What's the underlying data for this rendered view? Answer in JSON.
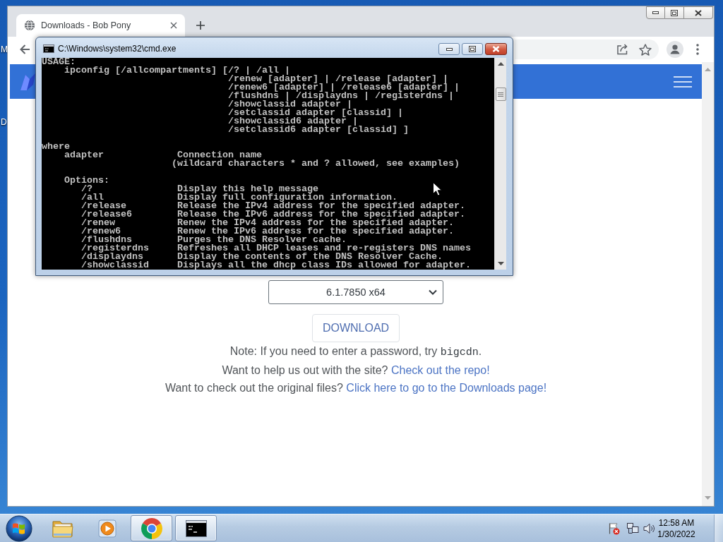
{
  "desktop": {
    "icon_labels": [
      "M",
      "D"
    ]
  },
  "browser": {
    "tabs": [
      {
        "title": "Downloads - Bob Pony",
        "selected": true
      }
    ],
    "page": {
      "version_select": {
        "value": "6.1.7850 x64"
      },
      "download_button": "DOWNLOAD",
      "notes": [
        {
          "segments": [
            {
              "kind": "text",
              "text": "Note: If you need to enter a password, try "
            },
            {
              "kind": "code",
              "text": "bigcdn"
            },
            {
              "kind": "text",
              "text": "."
            }
          ]
        },
        {
          "segments": [
            {
              "kind": "text",
              "text": "Want to help us out with the site? "
            },
            {
              "kind": "link",
              "text": "Check out the repo!"
            }
          ]
        },
        {
          "segments": [
            {
              "kind": "text",
              "text": "Want to check out the original files? "
            },
            {
              "kind": "link",
              "text": "Click here to go to the Downloads page!"
            }
          ]
        }
      ]
    }
  },
  "console_window": {
    "title": "C:\\Windows\\system32\\cmd.exe",
    "blocks": [
      [
        "USAGE:",
        "    ipconfig [/allcompartments] [/? | /all |",
        "                                 /renew [adapter] | /release [adapter] |",
        "                                 /renew6 [adapter] | /release6 [adapter] |",
        "                                 /flushdns | /displaydns | /registerdns |",
        "                                 /showclassid adapter |",
        "                                 /setclassid adapter [classid] |",
        "                                 /showclassid6 adapter |",
        "                                 /setclassid6 adapter [classid] ]"
      ],
      [
        "where",
        "    adapter             Connection name",
        "                       (wildcard characters * and ? allowed, see examples)"
      ],
      [
        "    Options:",
        "       /?               Display this help message",
        "       /all             Display full configuration information.",
        "       /release         Release the IPv4 address for the specified adapter.",
        "       /release6        Release the IPv6 address for the specified adapter.",
        "       /renew           Renew the IPv4 address for the specified adapter.",
        "       /renew6          Renew the IPv6 address for the specified adapter.",
        "       /flushdns        Purges the DNS Resolver cache.",
        "       /registerdns     Refreshes all DHCP leases and re-registers DNS names",
        "       /displaydns      Display the contents of the DNS Resolver Cache.",
        "       /showclassid     Displays all the dhcp class IDs allowed for adapter."
      ]
    ]
  },
  "taskbar": {
    "apps": [
      {
        "kind": "file-explorer",
        "running": false
      },
      {
        "kind": "media-player",
        "running": false
      },
      {
        "kind": "web-browser",
        "running": true
      },
      {
        "kind": "command-prompt",
        "running": true
      }
    ],
    "clock": {
      "time": "12:58 AM",
      "date": "1/30/2022"
    }
  }
}
